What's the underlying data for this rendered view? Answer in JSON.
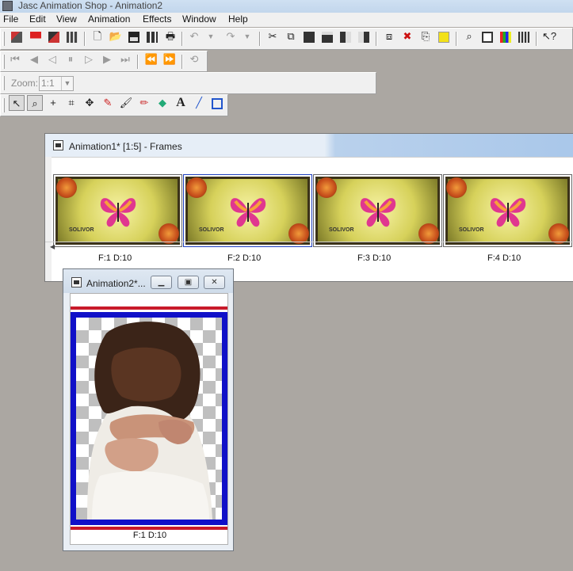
{
  "app": {
    "title": "Jasc Animation Shop - Animation2"
  },
  "menu": [
    "File",
    "Edit",
    "View",
    "Animation",
    "Effects",
    "Window",
    "Help"
  ],
  "toolbar": {
    "zoom_label": "Zoom:",
    "zoom_value": "1:1",
    "text_tool": "A"
  },
  "frames_window": {
    "title": "Animation1* [1:5] - Frames",
    "watermark": "SOLIVOR",
    "frames": [
      {
        "label": "F:1   D:10"
      },
      {
        "label": "F:2   D:10"
      },
      {
        "label": "F:3   D:10"
      },
      {
        "label": "F:4   D:10"
      }
    ]
  },
  "anim_window": {
    "title": "Animation2*...",
    "frame_label": "F:1   D:10"
  },
  "colors": {
    "frame_border_red": "#c81a2a",
    "frame_border_blue": "#1010c8",
    "selected_frame": "#1e3fbf"
  }
}
